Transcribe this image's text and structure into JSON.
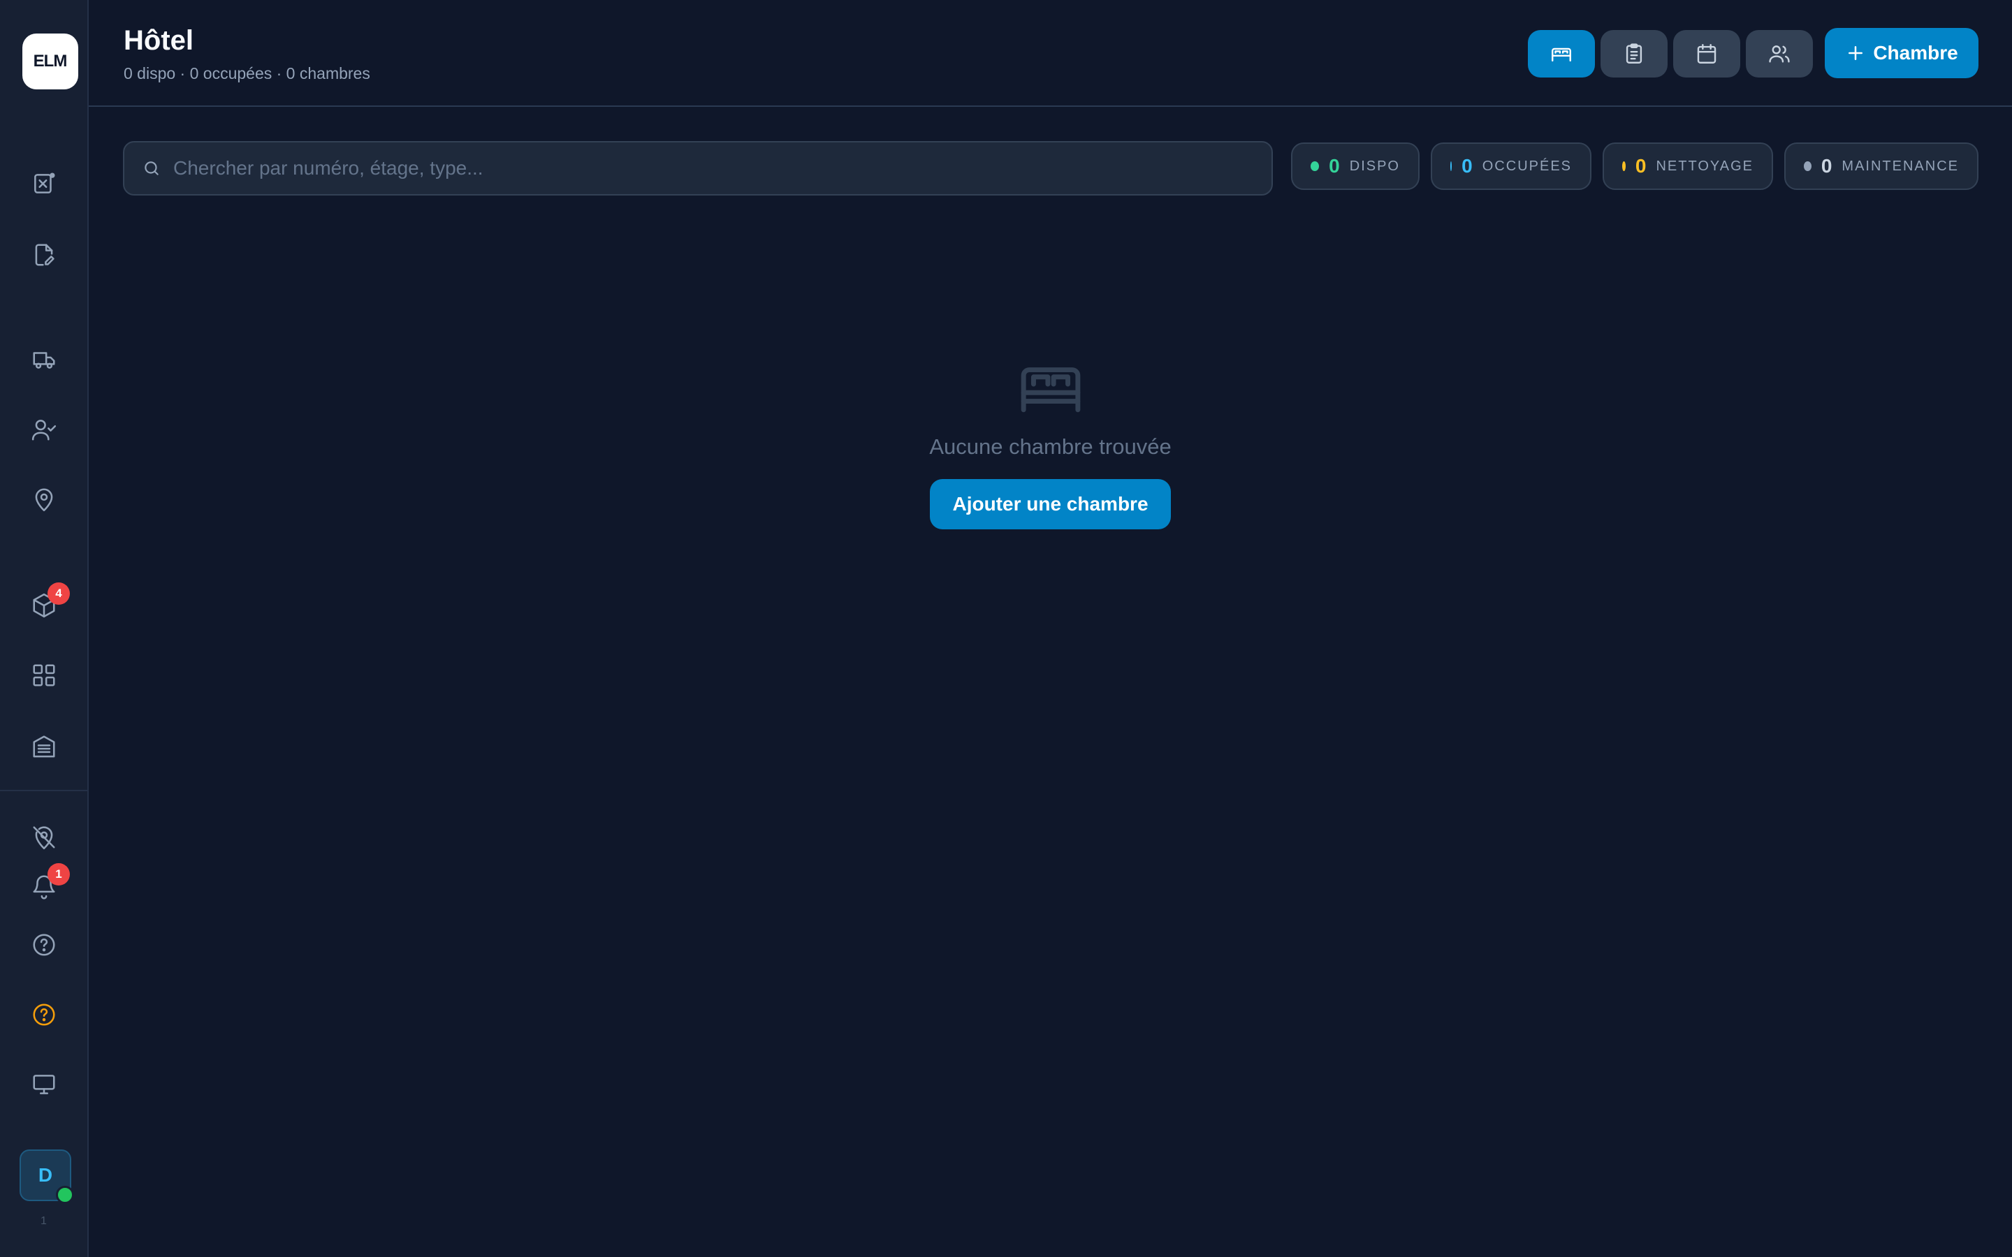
{
  "app": {
    "logo_text": "ELM",
    "logo_sub": "",
    "version": "1"
  },
  "header": {
    "title": "Hôtel",
    "subtitle": "0 dispo · 0 occupées · 0 chambres",
    "add_button_label": "Chambre",
    "view_buttons": [
      {
        "icon": "bed-icon",
        "active": true
      },
      {
        "icon": "clipboard-icon",
        "active": false
      },
      {
        "icon": "calendar-icon",
        "active": false
      },
      {
        "icon": "users-icon",
        "active": false
      }
    ]
  },
  "search": {
    "placeholder": "Chercher par numéro, étage, type...",
    "value": ""
  },
  "status_filters": [
    {
      "count": "0",
      "label": "DISPO",
      "color": "#34d399"
    },
    {
      "count": "0",
      "label": "OCCUPÉES",
      "color": "#38bdf8"
    },
    {
      "count": "0",
      "label": "NETTOYAGE",
      "color": "#fbbf24"
    },
    {
      "count": "0",
      "label": "MAINTENANCE",
      "color": "#94a3b8"
    }
  ],
  "empty_state": {
    "message": "Aucune chambre trouvée",
    "button_label": "Ajouter une chambre"
  },
  "sidebar": {
    "items": [
      {
        "icon": "dispatch-icon"
      },
      {
        "icon": "document-edit-icon"
      },
      {
        "icon": "truck-icon"
      },
      {
        "icon": "user-check-icon"
      },
      {
        "icon": "map-pin-icon"
      },
      {
        "icon": "package-icon",
        "badge": "4"
      },
      {
        "icon": "grid-icon"
      },
      {
        "icon": "building-icon"
      },
      {
        "icon": "location-off-icon"
      },
      {
        "icon": "bell-icon",
        "badge": "1"
      },
      {
        "icon": "help-icon"
      },
      {
        "icon": "help-highlight-icon",
        "color": "#f59e0b"
      },
      {
        "icon": "monitor-icon"
      }
    ],
    "avatar_initial": "D"
  }
}
